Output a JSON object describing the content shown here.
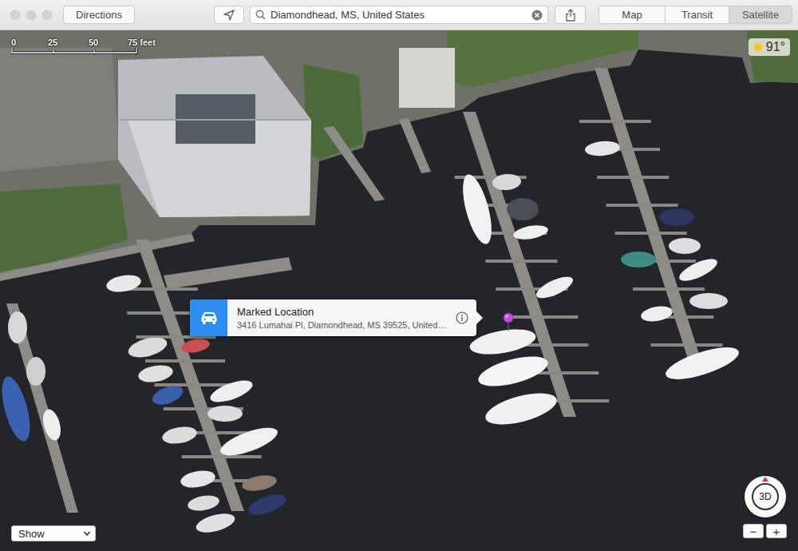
{
  "toolbar": {
    "buttons": [
      {
        "label": "Directions"
      }
    ],
    "search": {
      "value": "Diamondhead, MS, United States"
    },
    "view_tabs": [
      {
        "label": "Map",
        "selected": false
      },
      {
        "label": "Transit",
        "selected": false
      },
      {
        "label": "Satellite",
        "selected": true
      }
    ]
  },
  "scale": {
    "ticks": [
      "0",
      "25",
      "50",
      "75 feet"
    ]
  },
  "weather": {
    "temperature": "91°"
  },
  "callout": {
    "title": "Marked Location",
    "subtitle": "3416 Lumahai Pl, Diamondhead, MS  39525, United…"
  },
  "controls": {
    "compass": "3D",
    "zoom_out": "−",
    "zoom_in": "+"
  },
  "show_menu": {
    "value": "Show"
  }
}
